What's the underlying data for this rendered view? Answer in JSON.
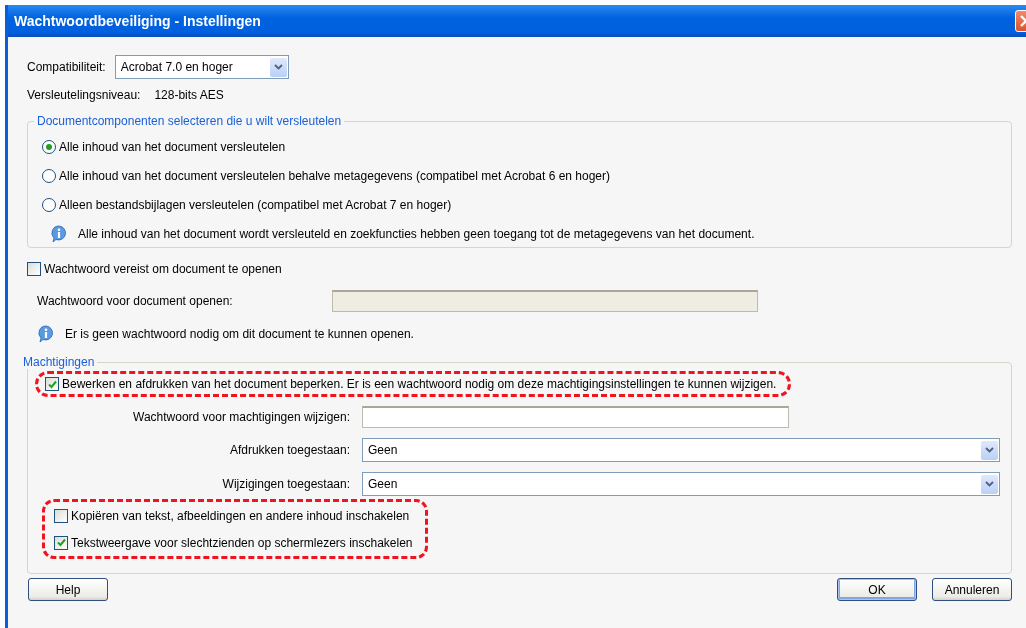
{
  "window": {
    "title": "Wachtwoordbeveiliging - Instellingen"
  },
  "compatibility": {
    "label": "Compatibiliteit:",
    "value": "Acrobat 7.0 en hoger"
  },
  "encryption": {
    "label": "Versleutelingsniveau:",
    "value": "128-bits AES"
  },
  "components": {
    "legend": "Documentcomponenten selecteren die u wilt versleutelen",
    "options": [
      {
        "label": "Alle inhoud van het document versleutelen",
        "selected": true
      },
      {
        "label": "Alle inhoud van het document versleutelen behalve metagegevens (compatibel met Acrobat 6 en hoger)",
        "selected": false
      },
      {
        "label": "Alleen bestandsbijlagen versleutelen (compatibel met Acrobat 7 en hoger)",
        "selected": false
      }
    ],
    "info": "Alle inhoud van het document wordt versleuteld en zoekfuncties hebben geen toegang tot de metagegevens van het document."
  },
  "open_password": {
    "checkbox": {
      "label": "Wachtwoord vereist om document te openen",
      "checked": false
    },
    "field_label": "Wachtwoord voor document openen:",
    "field_disabled": true,
    "info": "Er is geen wachtwoord nodig om dit document te kunnen openen."
  },
  "permissions": {
    "legend": "Machtigingen",
    "restrict": {
      "label": "Bewerken en afdrukken van het document beperken. Er is een wachtwoord nodig om deze machtigingsinstellingen te kunnen wijzigen.",
      "checked": true,
      "highlighted": true
    },
    "password_label": "Wachtwoord voor machtigingen wijzigen:",
    "printing": {
      "label": "Afdrukken toegestaan:",
      "value": "Geen"
    },
    "changes": {
      "label": "Wijzigingen toegestaan:",
      "value": "Geen"
    },
    "options_highlighted": true,
    "options": [
      {
        "label": "Kopiëren van tekst, afbeeldingen en andere inhoud inschakelen",
        "checked": false
      },
      {
        "label": "Tekstweergave voor slechtzienden op schermlezers inschakelen",
        "checked": true
      }
    ]
  },
  "help_button": "Help",
  "buttons": [
    {
      "label": "OK",
      "default": true
    },
    {
      "label": "Annuleren",
      "default": false
    }
  ]
}
